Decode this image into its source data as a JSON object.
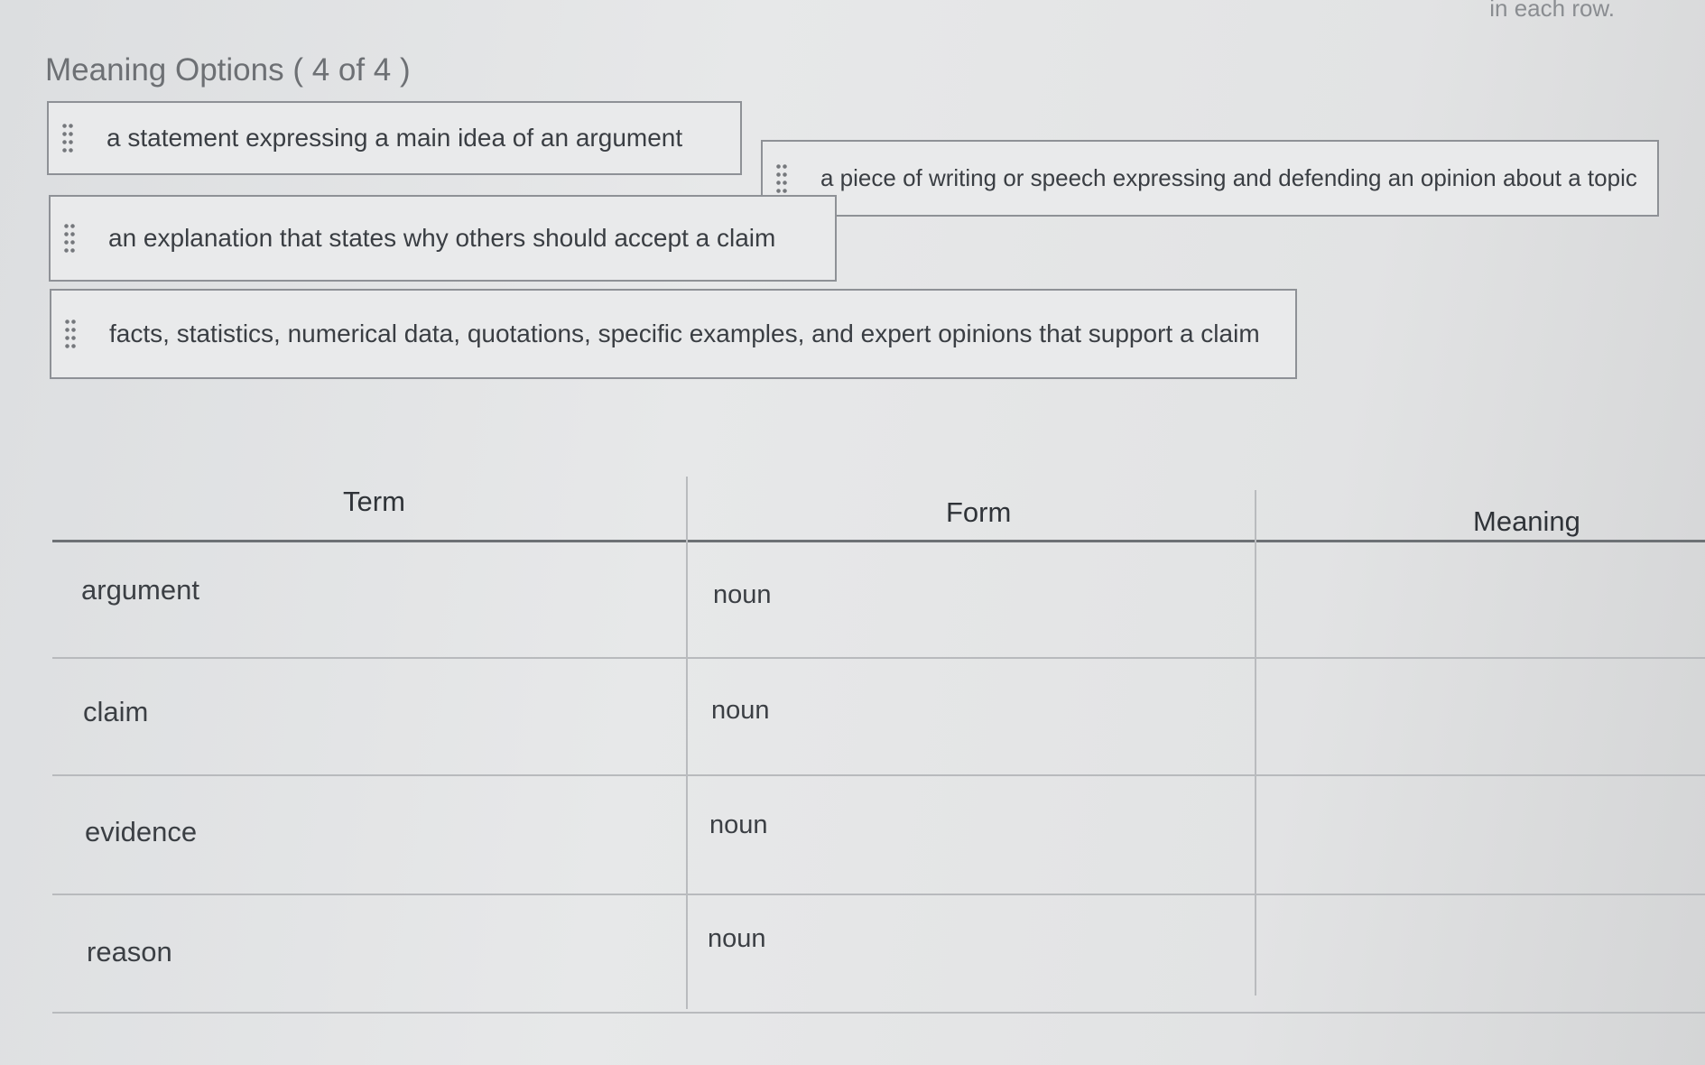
{
  "instruction": "in each row.",
  "options_title": "Meaning Options ( 4 of 4 )",
  "options": [
    "a statement expressing a main idea of an argument",
    "a piece of writing or speech expressing and defending an opinion about a topic",
    "an explanation that states why others should accept a claim",
    "facts, statistics, numerical data, quotations, specific examples, and expert opinions that support a claim"
  ],
  "table": {
    "headers": {
      "term": "Term",
      "form": "Form",
      "meaning": "Meaning"
    },
    "rows": [
      {
        "term": "argument",
        "form": "noun",
        "meaning": ""
      },
      {
        "term": "claim",
        "form": "noun",
        "meaning": ""
      },
      {
        "term": "evidence",
        "form": "noun",
        "meaning": ""
      },
      {
        "term": "reason",
        "form": "noun",
        "meaning": ""
      }
    ]
  }
}
